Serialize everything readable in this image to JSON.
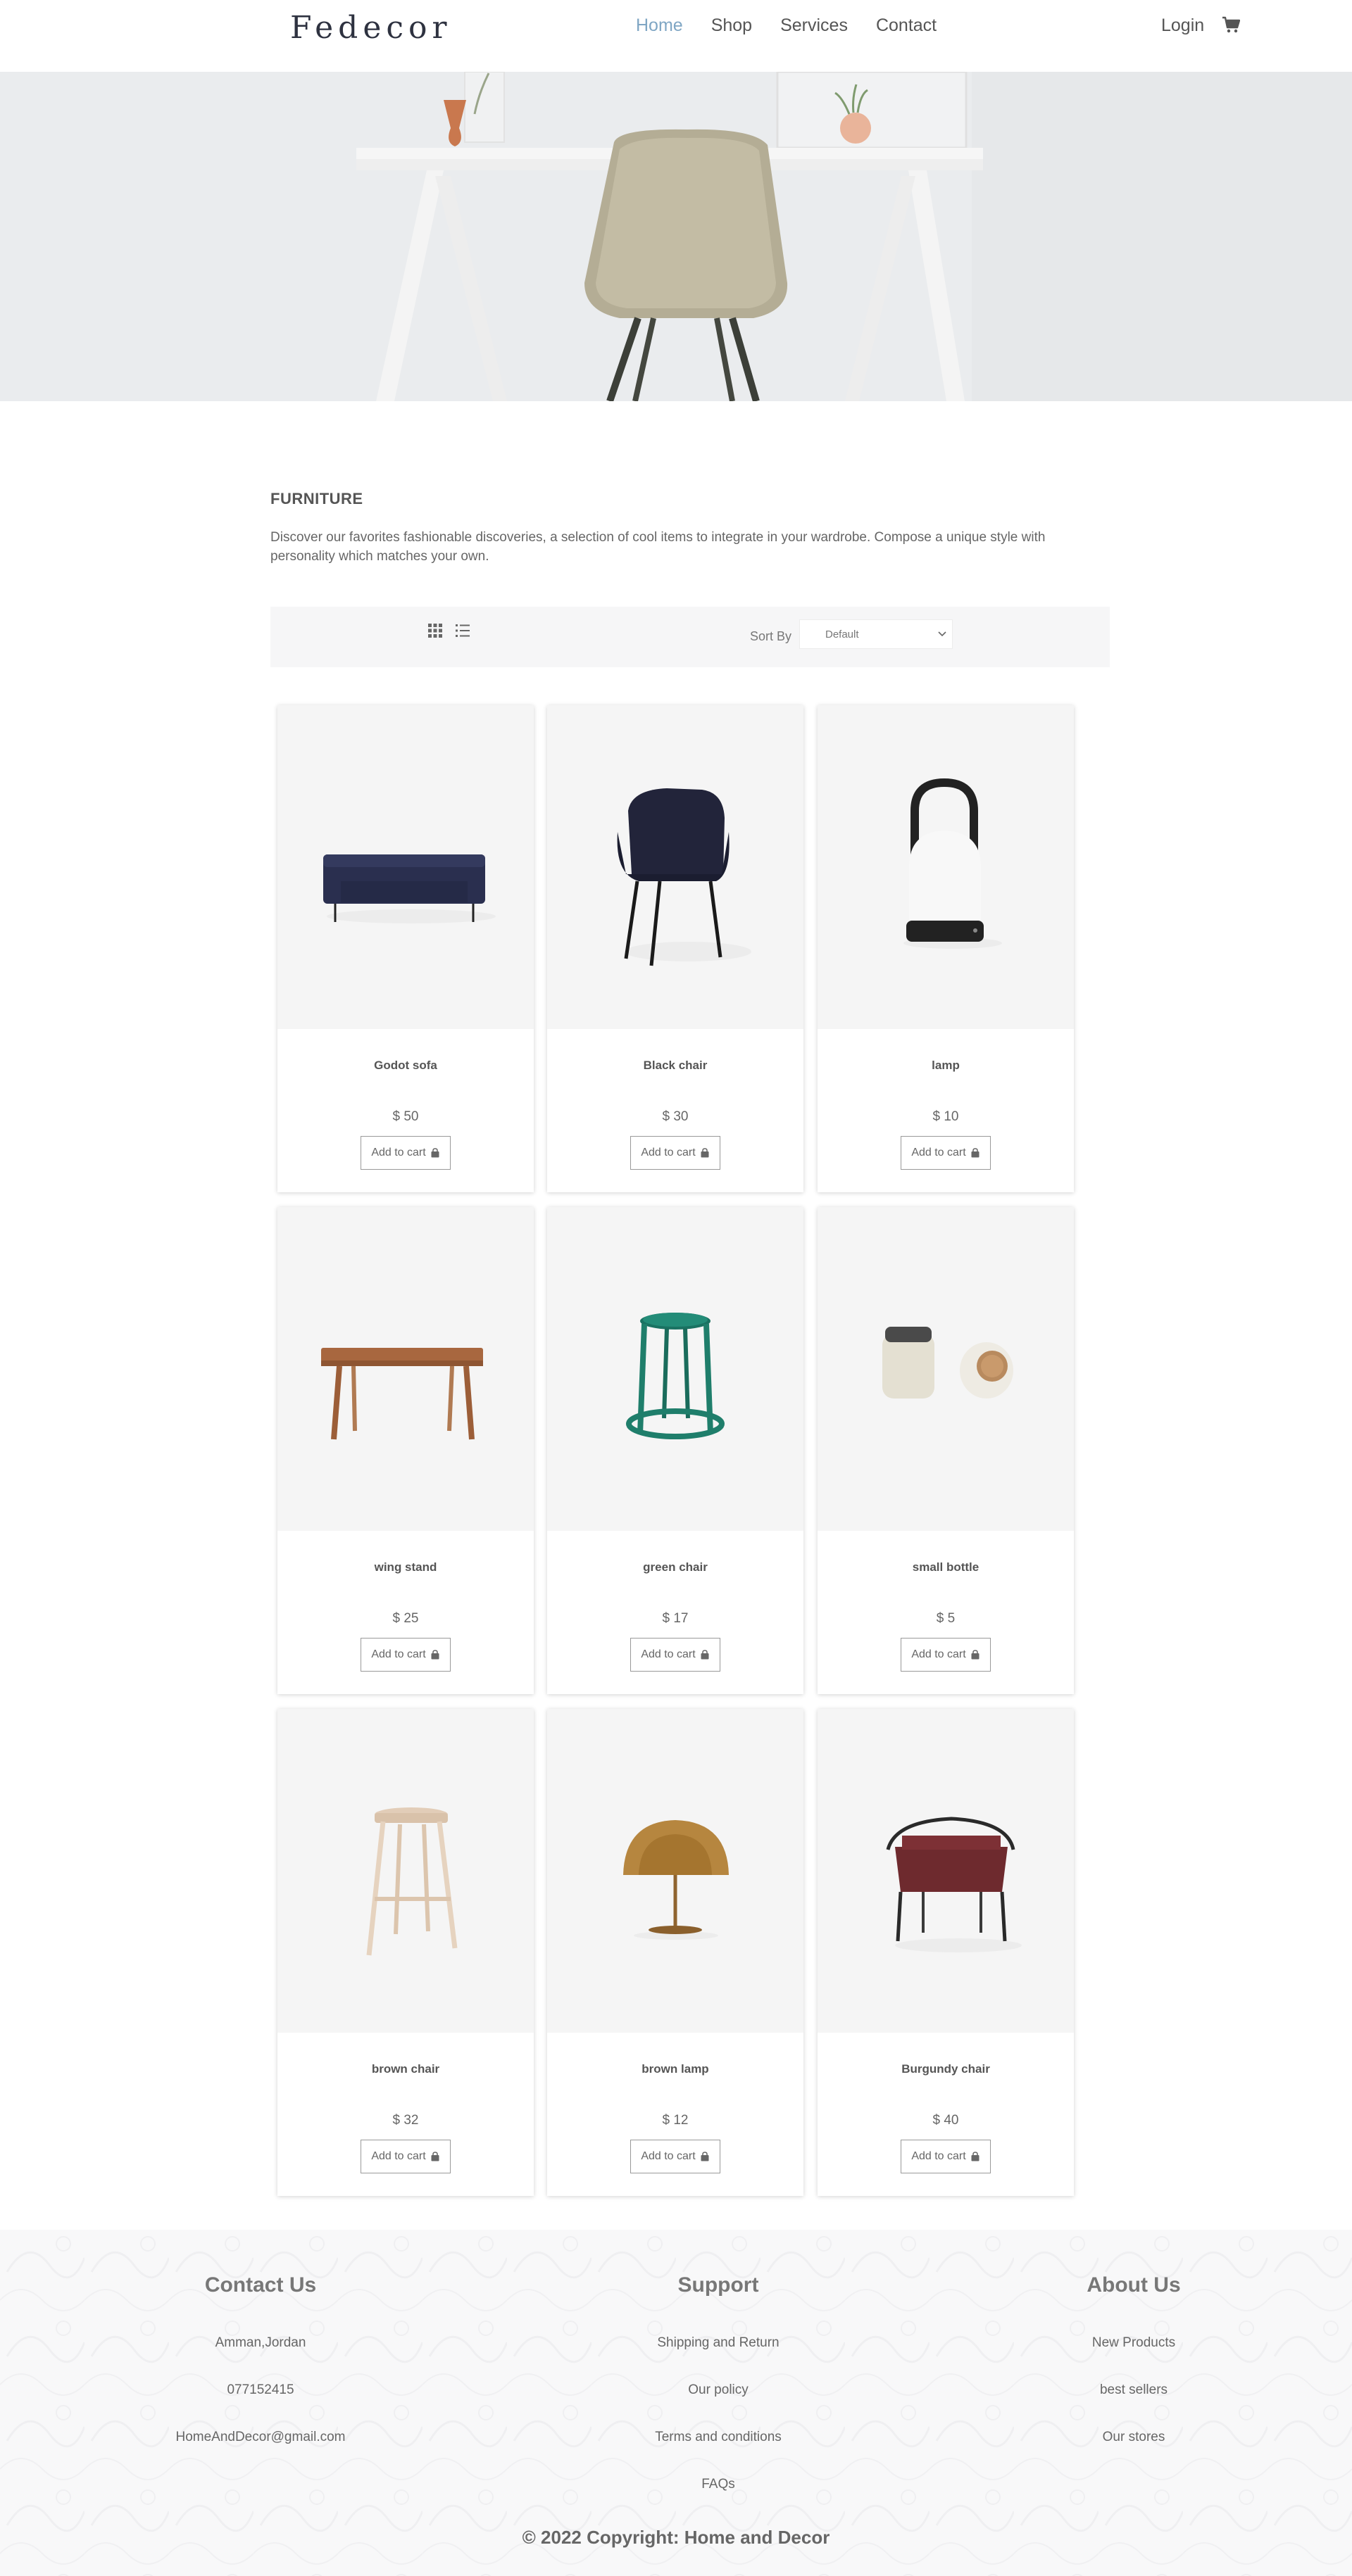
{
  "nav": {
    "logo": "Fedecor",
    "links": [
      "Home",
      "Shop",
      "Services",
      "Contact"
    ],
    "active_link": "Home",
    "login": "Login",
    "cart_icon": "shopping-cart-icon"
  },
  "colors": {
    "accent": "#7fa6c4",
    "text": "#555555",
    "toolbar_bg": "#f6f6f7",
    "footer_bg": "#f8f8f9"
  },
  "intro": {
    "title": "FURNITURE",
    "description": "Discover our favorites fashionable discoveries, a selection of cool items to integrate in your wardrobe. Compose a unique style with personality which matches your own."
  },
  "toolbar": {
    "grid_icon": "grid-view-icon",
    "list_icon": "list-view-icon",
    "sort_label": "Sort By",
    "sort_value": "Default"
  },
  "products": [
    {
      "name": "Godot sofa",
      "price": "$ 50",
      "button": "Add to cart",
      "image": "navy-sofa"
    },
    {
      "name": "Black chair",
      "price": "$ 30",
      "button": "Add to cart",
      "image": "black-armchair"
    },
    {
      "name": "lamp",
      "price": "$ 10",
      "button": "Add to cart",
      "image": "lantern-lamp"
    },
    {
      "name": "wing stand",
      "price": "$ 25",
      "button": "Add to cart",
      "image": "wooden-bench"
    },
    {
      "name": "green chair",
      "price": "$ 17",
      "button": "Add to cart",
      "image": "green-stool"
    },
    {
      "name": "small bottle",
      "price": "$ 5",
      "button": "Add to cart",
      "image": "ceramic-bottles"
    },
    {
      "name": "brown chair",
      "price": "$ 32",
      "button": "Add to cart",
      "image": "wooden-bar-stool"
    },
    {
      "name": "brown lamp",
      "price": "$ 12",
      "button": "Add to cart",
      "image": "copper-dome-lamp"
    },
    {
      "name": "Burgundy chair",
      "price": "$ 40",
      "button": "Add to cart",
      "image": "burgundy-chair"
    }
  ],
  "footer": {
    "contact": {
      "title": "Contact Us",
      "items": [
        "Amman,Jordan",
        "077152415",
        "HomeAndDecor@gmail.com"
      ]
    },
    "support": {
      "title": "Support",
      "items": [
        "Shipping and Return",
        "Our policy",
        "Terms and conditions",
        "FAQs"
      ]
    },
    "about": {
      "title": "About Us",
      "items": [
        "New Products",
        "best sellers",
        "Our stores"
      ]
    },
    "copyright": "© 2022 Copyright: Home and Decor"
  }
}
